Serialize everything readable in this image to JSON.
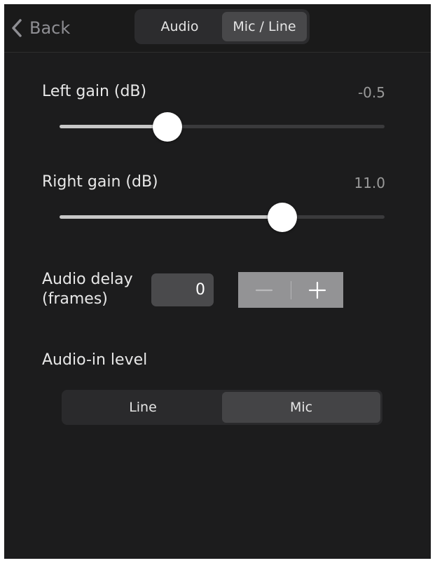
{
  "header": {
    "back_label": "Back",
    "tabs": [
      {
        "label": "Audio",
        "active": false
      },
      {
        "label": "Mic / Line",
        "active": true
      }
    ]
  },
  "left_gain": {
    "label": "Left gain (dB)",
    "value_text": "-0.5",
    "slider_fraction": 0.332
  },
  "right_gain": {
    "label": "Right gain (dB)",
    "value_text": "11.0",
    "slider_fraction": 0.685
  },
  "audio_delay": {
    "label_line1": "Audio delay",
    "label_line2": "(frames)",
    "value": "0",
    "decrement_icon": "minus-icon",
    "increment_icon": "plus-icon"
  },
  "audio_in_level": {
    "label": "Audio-in level",
    "options": [
      {
        "label": "Line",
        "active": false
      },
      {
        "label": "Mic",
        "active": true
      }
    ]
  },
  "colors": {
    "background": "#1c1c1d",
    "thumb": "#ffffff",
    "track_fill": "#c7c7c7",
    "track_empty": "#3a3a3c",
    "stepper": "#939395"
  }
}
